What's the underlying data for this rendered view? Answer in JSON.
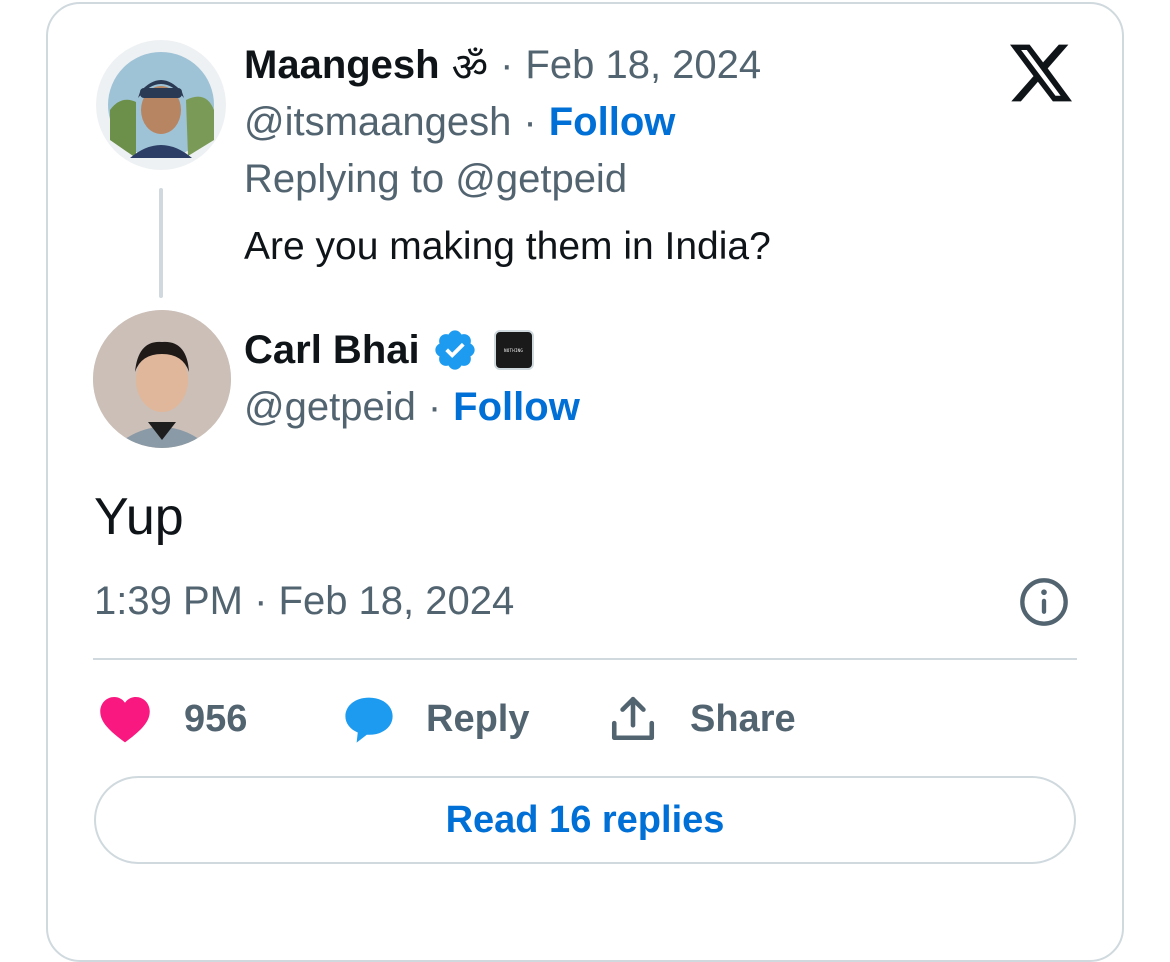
{
  "brand": {
    "logo_icon": "x-logo-icon"
  },
  "parent_tweet": {
    "author_name": "Maangesh",
    "author_emoji": "ॐ",
    "date": "Feb 18, 2024",
    "handle": "@itsmaangesh",
    "follow_label": "Follow",
    "replying_to": "Replying to @getpeid",
    "text": "Are you making them in India?"
  },
  "main_tweet": {
    "author_name": "Carl Bhai",
    "verified_icon": "verified-badge-icon",
    "affiliate_icon": "nothing-logo-icon",
    "affiliate_text": "NOTHING",
    "handle": "@getpeid",
    "follow_label": "Follow",
    "text": "Yup",
    "timestamp": "1:39 PM · Feb 18, 2024"
  },
  "actions": {
    "like_count": "956",
    "reply_label": "Reply",
    "share_label": "Share"
  },
  "read_replies_label": "Read 16 replies",
  "separator": "·",
  "colors": {
    "link": "#006fd6",
    "heart": "#f91880",
    "reply_bubble": "#1d9bf0",
    "verified": "#1d9bf0",
    "muted": "#536471",
    "border": "#cfd9de"
  }
}
